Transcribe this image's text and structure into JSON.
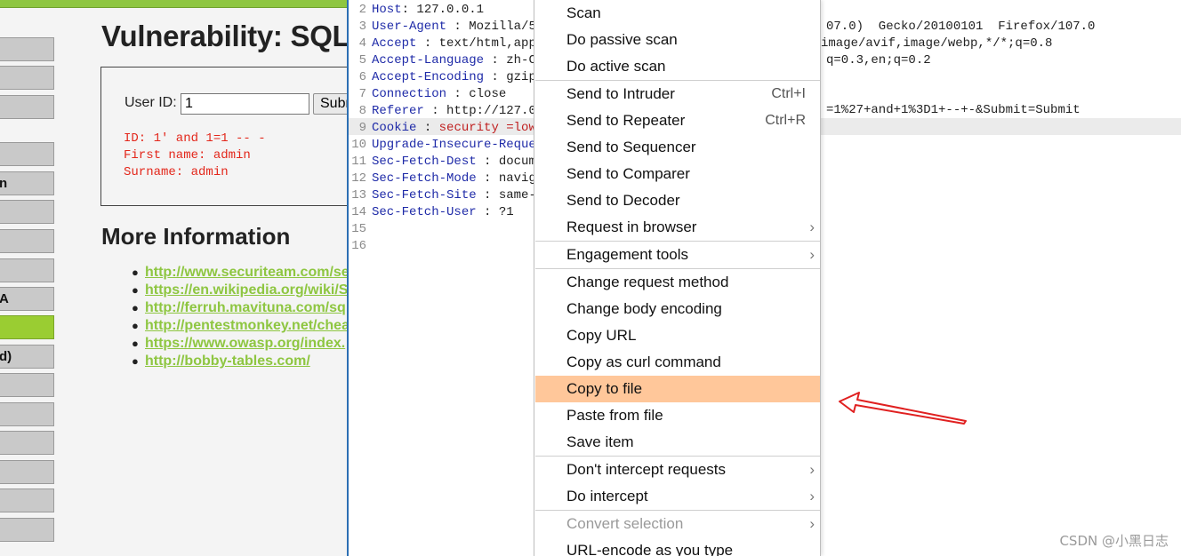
{
  "dvwa": {
    "title": "Vulnerability: SQL",
    "menu": [
      {
        "label": "",
        "active": false
      },
      {
        "label": "",
        "active": false
      },
      {
        "label": "",
        "active": false
      },
      {
        "label": "",
        "active": false
      },
      {
        "label": "n",
        "active": false
      },
      {
        "label": "",
        "active": false
      },
      {
        "label": "",
        "active": false
      },
      {
        "label": "",
        "active": false
      },
      {
        "label": "A",
        "active": false
      },
      {
        "label": "",
        "active": true
      },
      {
        "label": "d)",
        "active": false
      },
      {
        "label": "",
        "active": false
      },
      {
        "label": "",
        "active": false
      },
      {
        "label": "",
        "active": false
      },
      {
        "label": "",
        "active": false
      },
      {
        "label": "",
        "active": false
      },
      {
        "label": "",
        "active": false
      }
    ],
    "form": {
      "user_id_label": "User ID:",
      "user_id_value": "1",
      "submit_label": "Submit"
    },
    "result": [
      "ID: 1' and 1=1 -- -",
      "First name: admin",
      "Surname: admin"
    ],
    "more_info_title": "More Information",
    "links": [
      "http://www.securiteam.com/se",
      "https://en.wikipedia.org/wiki/S",
      "http://ferruh.mavituna.com/sq",
      "http://pentestmonkey.net/chea",
      "https://www.owasp.org/index.",
      "http://bobby-tables.com/"
    ],
    "colors": {
      "accent": "#8ec641",
      "error": "#e3271b"
    }
  },
  "editor": {
    "lines": [
      {
        "n": "2",
        "key": "Host",
        "sep": ": ",
        "val": "127.0.0.1"
      },
      {
        "n": "3",
        "key": "User-Agent",
        "sep": " : ",
        "val": "Mozilla/5."
      },
      {
        "n": "4",
        "key": "Accept",
        "sep": " : ",
        "val": "text/html,appl"
      },
      {
        "n": "5",
        "key": "Accept-Language",
        "sep": " : ",
        "val": "zh-C"
      },
      {
        "n": "6",
        "key": "Accept-Encoding",
        "sep": " : ",
        "val": "gzip"
      },
      {
        "n": "7",
        "key": "Connection",
        "sep": " : ",
        "val": "close"
      },
      {
        "n": "8",
        "key": "Referer",
        "sep": " : ",
        "val": "http://127.0."
      },
      {
        "n": "9",
        "key": "Cookie",
        "sep": " : ",
        "val": "security =low;",
        "cookie": true
      },
      {
        "n": "10",
        "key": "Upgrade-Insecure-Reques",
        "sep": "",
        "val": ""
      },
      {
        "n": "11",
        "key": "Sec-Fetch-Dest",
        "sep": " : ",
        "val": "docume"
      },
      {
        "n": "12",
        "key": "Sec-Fetch-Mode",
        "sep": " : ",
        "val": "naviga"
      },
      {
        "n": "13",
        "key": "Sec-Fetch-Site",
        "sep": " : ",
        "val": "same-o"
      },
      {
        "n": "14",
        "key": "Sec-Fetch-User",
        "sep": " : ",
        "val": "?1"
      },
      {
        "n": "15",
        "key": "",
        "sep": "",
        "val": ""
      },
      {
        "n": "16",
        "key": "",
        "sep": "",
        "val": ""
      }
    ],
    "tails": {
      "user_agent": "07.0)  Gecko/20100101  Firefox/107.0",
      "accept": "image/avif,image/webp,*/*;q=0.8",
      "accept_language": "q=0.3,en;q=0.2",
      "referer": "=1%27+and+1%3D1+--+-&Submit=Submit"
    }
  },
  "context_menu": {
    "items": [
      {
        "label": "Scan",
        "shortcut": "",
        "submenu": false,
        "highlighted": false,
        "disabled": false,
        "sep_before": false
      },
      {
        "label": "Do passive scan",
        "shortcut": "",
        "submenu": false,
        "highlighted": false,
        "disabled": false,
        "sep_before": false
      },
      {
        "label": "Do active scan",
        "shortcut": "",
        "submenu": false,
        "highlighted": false,
        "disabled": false,
        "sep_before": false
      },
      {
        "label": "Send to Intruder",
        "shortcut": "Ctrl+I",
        "submenu": false,
        "highlighted": false,
        "disabled": false,
        "sep_before": true
      },
      {
        "label": "Send to Repeater",
        "shortcut": "Ctrl+R",
        "submenu": false,
        "highlighted": false,
        "disabled": false,
        "sep_before": false
      },
      {
        "label": "Send to Sequencer",
        "shortcut": "",
        "submenu": false,
        "highlighted": false,
        "disabled": false,
        "sep_before": false
      },
      {
        "label": "Send to Comparer",
        "shortcut": "",
        "submenu": false,
        "highlighted": false,
        "disabled": false,
        "sep_before": false
      },
      {
        "label": "Send to Decoder",
        "shortcut": "",
        "submenu": false,
        "highlighted": false,
        "disabled": false,
        "sep_before": false
      },
      {
        "label": "Request in browser",
        "shortcut": "",
        "submenu": true,
        "highlighted": false,
        "disabled": false,
        "sep_before": false
      },
      {
        "label": "Engagement tools",
        "shortcut": "",
        "submenu": true,
        "highlighted": false,
        "disabled": false,
        "sep_before": true
      },
      {
        "label": "Change request method",
        "shortcut": "",
        "submenu": false,
        "highlighted": false,
        "disabled": false,
        "sep_before": true
      },
      {
        "label": "Change body encoding",
        "shortcut": "",
        "submenu": false,
        "highlighted": false,
        "disabled": false,
        "sep_before": false
      },
      {
        "label": "Copy URL",
        "shortcut": "",
        "submenu": false,
        "highlighted": false,
        "disabled": false,
        "sep_before": false
      },
      {
        "label": "Copy as curl command",
        "shortcut": "",
        "submenu": false,
        "highlighted": false,
        "disabled": false,
        "sep_before": false
      },
      {
        "label": "Copy to file",
        "shortcut": "",
        "submenu": false,
        "highlighted": true,
        "disabled": false,
        "sep_before": false
      },
      {
        "label": "Paste from file",
        "shortcut": "",
        "submenu": false,
        "highlighted": false,
        "disabled": false,
        "sep_before": false
      },
      {
        "label": "Save item",
        "shortcut": "",
        "submenu": false,
        "highlighted": false,
        "disabled": false,
        "sep_before": false
      },
      {
        "label": "Don't intercept requests",
        "shortcut": "",
        "submenu": true,
        "highlighted": false,
        "disabled": false,
        "sep_before": true
      },
      {
        "label": "Do intercept",
        "shortcut": "",
        "submenu": true,
        "highlighted": false,
        "disabled": false,
        "sep_before": false
      },
      {
        "label": "Convert selection",
        "shortcut": "",
        "submenu": true,
        "highlighted": false,
        "disabled": true,
        "sep_before": true
      },
      {
        "label": "URL-encode as you type",
        "shortcut": "",
        "submenu": false,
        "highlighted": false,
        "disabled": false,
        "sep_before": false
      }
    ],
    "highlight_color": "#ffc79a"
  },
  "annotation": {
    "arrow_color": "#e02020",
    "icon": "red-arrow-icon"
  },
  "watermark": "CSDN @小黑日志"
}
